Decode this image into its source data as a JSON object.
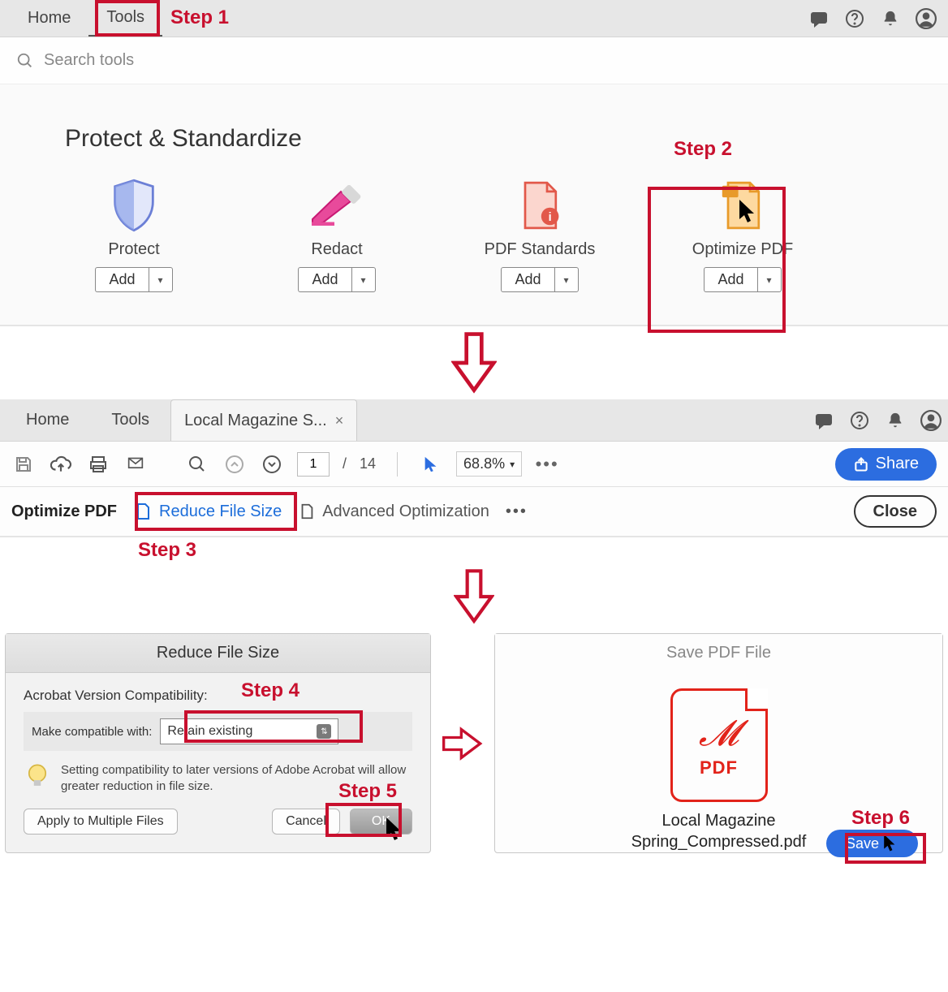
{
  "steps": {
    "s1": "Step 1",
    "s2": "Step 2",
    "s3": "Step 3",
    "s4": "Step 4",
    "s5": "Step 5",
    "s6": "Step 6"
  },
  "panel1": {
    "tabs": {
      "home": "Home",
      "tools": "Tools"
    },
    "search_placeholder": "Search tools",
    "section_title": "Protect & Standardize",
    "tools": [
      {
        "label": "Protect",
        "add": "Add"
      },
      {
        "label": "Redact",
        "add": "Add"
      },
      {
        "label": "PDF Standards",
        "add": "Add"
      },
      {
        "label": "Optimize PDF",
        "add": "Add"
      }
    ]
  },
  "panel2": {
    "tabs": {
      "home": "Home",
      "tools": "Tools",
      "doc": "Local Magazine S..."
    },
    "page_current": "1",
    "page_total": "14",
    "zoom": "68.8%",
    "share": "Share",
    "optbar": {
      "title": "Optimize PDF",
      "reduce": "Reduce File Size",
      "advanced": "Advanced Optimization",
      "close": "Close"
    }
  },
  "dialog1": {
    "title": "Reduce File Size",
    "compat_heading": "Acrobat Version Compatibility:",
    "make_compat": "Make compatible with:",
    "selected": "Retain existing",
    "tip": "Setting compatibility to later versions of Adobe Acrobat will allow greater reduction in file size.",
    "apply_multi": "Apply to Multiple Files",
    "cancel": "Cancel",
    "ok": "OK"
  },
  "dialog2": {
    "title": "Save PDF File",
    "pdf_label": "PDF",
    "filename_l1": "Local Magazine",
    "filename_l2": "Spring_Compressed.pdf",
    "save": "Save"
  }
}
